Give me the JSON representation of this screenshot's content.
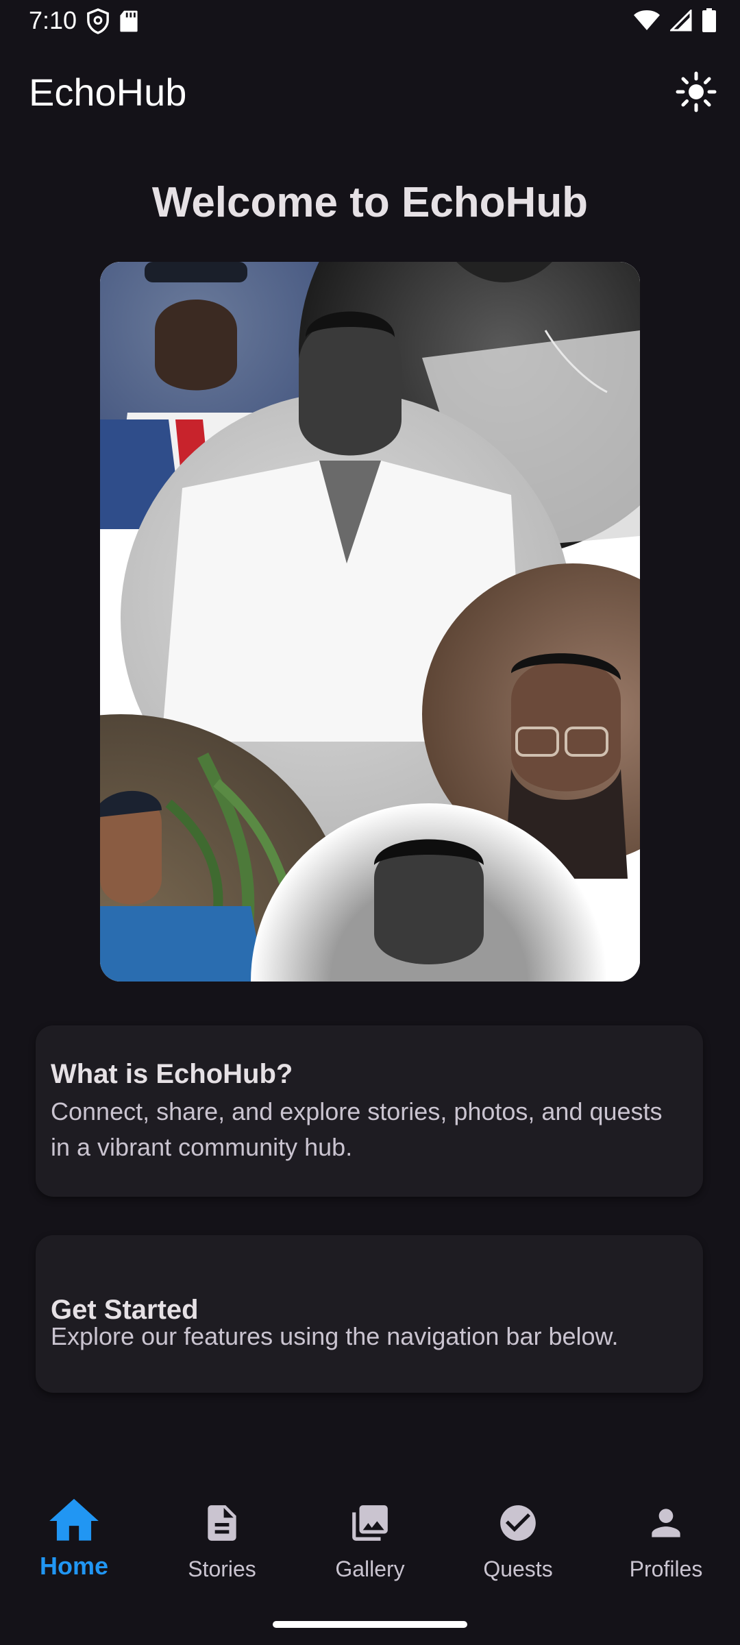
{
  "status_bar": {
    "time": "7:10",
    "left_icons": [
      "shield-icon",
      "sd-card-icon"
    ],
    "right_icons": [
      "wifi-icon",
      "cellular-signal-icon",
      "battery-icon"
    ]
  },
  "app_bar": {
    "title": "EchoHub",
    "action_icon": "light-mode-icon"
  },
  "main": {
    "welcome_title": "Welcome to EchoHub",
    "collage_alt": "profile-photo-collage",
    "cards": [
      {
        "title": "What is EchoHub?",
        "body": "Connect, share, and explore stories, photos, and quests in a vibrant community hub."
      },
      {
        "title": "Get Started",
        "body": "Explore our features using the navigation bar below."
      }
    ]
  },
  "bottom_nav": {
    "items": [
      {
        "label": "Home",
        "icon": "home-icon",
        "active": true
      },
      {
        "label": "Stories",
        "icon": "article-icon",
        "active": false
      },
      {
        "label": "Gallery",
        "icon": "photo-library-icon",
        "active": false
      },
      {
        "label": "Quests",
        "icon": "check-circle-icon",
        "active": false
      },
      {
        "label": "Profiles",
        "icon": "person-icon",
        "active": false
      }
    ]
  },
  "colors": {
    "background": "#141218",
    "card": "#1e1c22",
    "accent": "#2196f3",
    "text_primary": "#e6e1e5",
    "text_secondary": "#cac4d0"
  }
}
